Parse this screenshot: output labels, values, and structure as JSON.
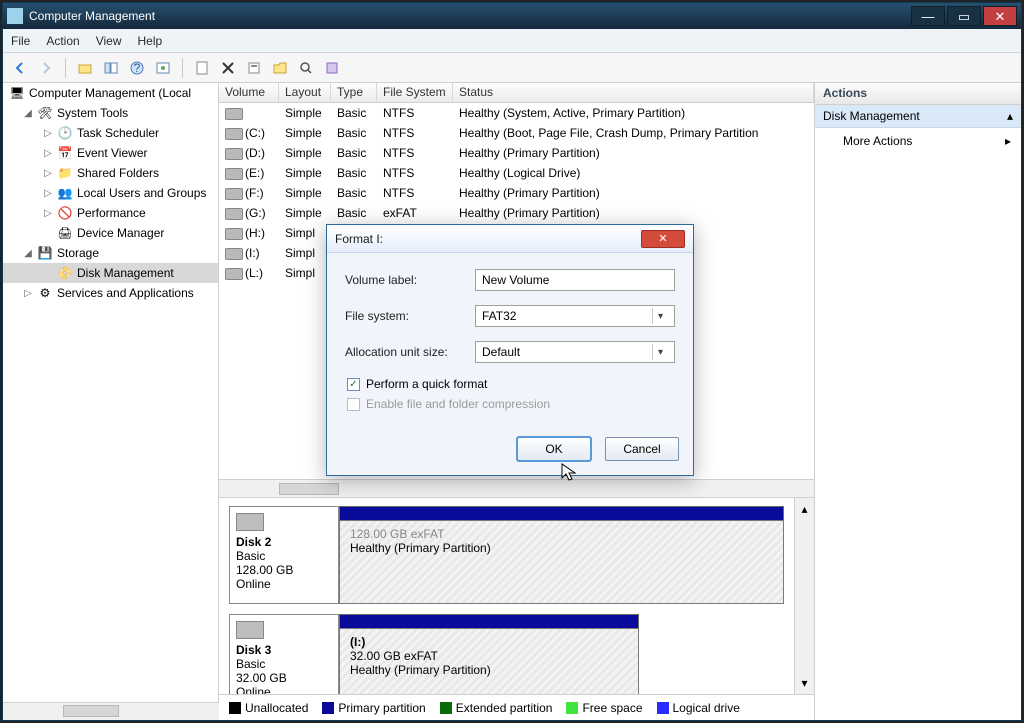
{
  "titlebar": {
    "title": "Computer Management"
  },
  "menu": {
    "file": "File",
    "action": "Action",
    "view": "View",
    "help": "Help"
  },
  "tree": {
    "root": "Computer Management (Local",
    "systools": "System Tools",
    "task": "Task Scheduler",
    "event": "Event Viewer",
    "shared": "Shared Folders",
    "localusers": "Local Users and Groups",
    "perf": "Performance",
    "devmgr": "Device Manager",
    "storage": "Storage",
    "diskmgmt": "Disk Management",
    "services": "Services and Applications"
  },
  "cols": {
    "vol": "Volume",
    "layout": "Layout",
    "type": "Type",
    "fs": "File System",
    "status": "Status"
  },
  "vols": [
    {
      "name": "",
      "layout": "Simple",
      "type": "Basic",
      "fs": "NTFS",
      "status": "Healthy (System, Active, Primary Partition)"
    },
    {
      "name": "(C:)",
      "layout": "Simple",
      "type": "Basic",
      "fs": "NTFS",
      "status": "Healthy (Boot, Page File, Crash Dump, Primary Partition"
    },
    {
      "name": "(D:)",
      "layout": "Simple",
      "type": "Basic",
      "fs": "NTFS",
      "status": "Healthy (Primary Partition)"
    },
    {
      "name": "(E:)",
      "layout": "Simple",
      "type": "Basic",
      "fs": "NTFS",
      "status": "Healthy (Logical Drive)"
    },
    {
      "name": "(F:)",
      "layout": "Simple",
      "type": "Basic",
      "fs": "NTFS",
      "status": "Healthy (Primary Partition)"
    },
    {
      "name": "(G:)",
      "layout": "Simple",
      "type": "Basic",
      "fs": "exFAT",
      "status": "Healthy (Primary Partition)"
    },
    {
      "name": "(H:)",
      "layout": "Simpl",
      "type": "",
      "fs": "",
      "status": ""
    },
    {
      "name": "(I:)",
      "layout": "Simpl",
      "type": "",
      "fs": "",
      "status": ""
    },
    {
      "name": "(L:)",
      "layout": "Simpl",
      "type": "",
      "fs": "",
      "status": ""
    }
  ],
  "actions": {
    "header": "Actions",
    "sub": "Disk Management",
    "more": "More Actions"
  },
  "disk2": {
    "title": "Disk 2",
    "type": "Basic",
    "size": "128.00 GB",
    "state": "Online",
    "p_status": "Healthy (Primary Partition)"
  },
  "disk3": {
    "title": "Disk 3",
    "type": "Basic",
    "size": "32.00 GB",
    "state": "Online",
    "p_label": "(I:)",
    "p_size": "32.00 GB exFAT",
    "p_status": "Healthy (Primary Partition)"
  },
  "legend": {
    "unalloc": "Unallocated",
    "primary": "Primary partition",
    "ext": "Extended partition",
    "free": "Free space",
    "logical": "Logical drive"
  },
  "legend_colors": {
    "unalloc": "#000",
    "primary": "#0a0a9a",
    "ext": "#0a6b0a",
    "free": "#3fe23f",
    "logical": "#2b2bff"
  },
  "dialog": {
    "title": "Format I:",
    "vol_label_lbl": "Volume label:",
    "vol_label": "New Volume",
    "fs_lbl": "File system:",
    "fs_val": "FAT32",
    "alloc_lbl": "Allocation unit size:",
    "alloc_val": "Default",
    "quick": "Perform a quick format",
    "compress": "Enable file and folder compression",
    "ok": "OK",
    "cancel": "Cancel"
  }
}
